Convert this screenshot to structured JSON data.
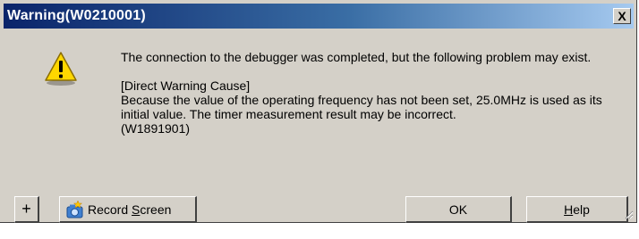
{
  "dialog": {
    "title": "Warning(W0210001)",
    "close_label": "X"
  },
  "message": {
    "intro": "The connection to the debugger was completed, but the following problem may exist.",
    "cause_header": "[Direct Warning Cause]",
    "cause_text": "Because the value of the operating frequency has not been set, 25.0MHz is used as its initial value. The timer measurement result may be incorrect.",
    "code": "(W1891901)"
  },
  "buttons": {
    "plus_label": "+",
    "record_prefix": "Record ",
    "record_underlined": "S",
    "record_suffix": "creen",
    "ok_label": "OK",
    "help_underlined": "H",
    "help_suffix": "elp"
  },
  "colors": {
    "title_gradient_start": "#0a246a",
    "title_gradient_end": "#a6caf0",
    "dialog_face": "#d4d0c8",
    "warning_yellow": "#ffd700"
  },
  "icons": {
    "warning": "warning-icon",
    "record": "camera-icon"
  }
}
